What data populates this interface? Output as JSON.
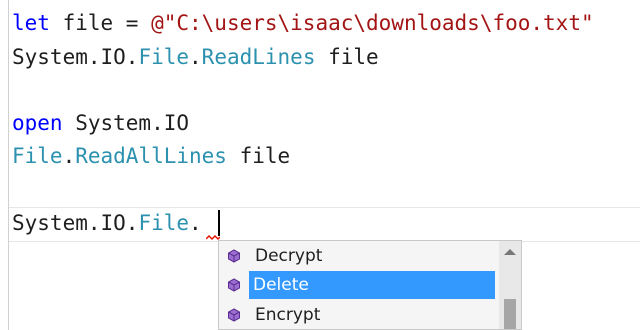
{
  "editor": {
    "lines": [
      {
        "kw": "let",
        "rest": " file = ",
        "str": "@\"C:\\users\\isaac\\downloads\\foo.txt\""
      },
      {
        "ns": "System.IO.",
        "type": "File",
        "dot": ".",
        "method": "ReadLines",
        "tail": " file"
      },
      {
        "kw": "open",
        "rest": " System.IO"
      },
      {
        "type": "File",
        "dot": ".",
        "method": "ReadAllLines",
        "tail": " file"
      },
      {
        "ns": "System.IO.",
        "type": "File",
        "dot": "."
      }
    ]
  },
  "completion": {
    "items": [
      {
        "label": "Decrypt",
        "icon": "method-cube-icon"
      },
      {
        "label": "Delete",
        "icon": "method-cube-icon",
        "selected": true
      },
      {
        "label": "Encrypt",
        "icon": "method-cube-icon"
      }
    ]
  },
  "colors": {
    "keyword": "#0000ff",
    "type": "#2b91af",
    "string": "#a31515",
    "selection": "#3399ff",
    "method_icon": "#6c3fa8"
  }
}
